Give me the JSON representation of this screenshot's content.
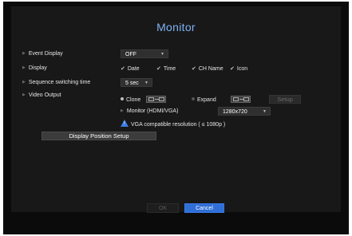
{
  "title": "Monitor",
  "event_display": {
    "label": "Event Display",
    "value": "OFF"
  },
  "display": {
    "label": "Display",
    "options": [
      {
        "label": "Date",
        "checked": true
      },
      {
        "label": "Time",
        "checked": true
      },
      {
        "label": "CH Name",
        "checked": true
      },
      {
        "label": "Icon",
        "checked": true
      }
    ]
  },
  "sequence": {
    "label": "Sequence switching time",
    "value": "5 sec"
  },
  "video_output": {
    "label": "Video Output",
    "clone_label": "Clone",
    "expand_label": "Expand",
    "selected": "Clone",
    "setup_label": "Setup",
    "monitor_label": "Monitor (HDMI/VGA)",
    "monitor_value": "1280x720",
    "warning_text": "VGA compatible resolution ( ≤ 1080p )"
  },
  "display_position_button": "Display Position Setup",
  "footer": {
    "ok_label": "OK",
    "cancel_label": "Cancel"
  },
  "colors": {
    "accent": "#2f6fd6",
    "title": "#7fb2f4",
    "background": "#181818"
  }
}
